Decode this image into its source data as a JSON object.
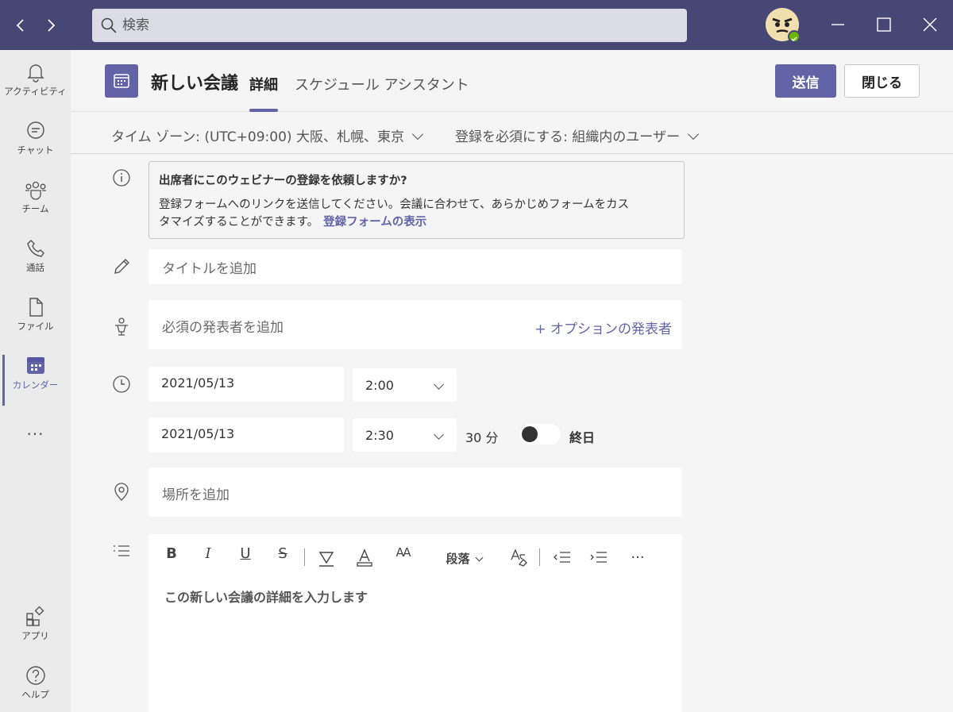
{
  "search": {
    "placeholder": "検索"
  },
  "rail": {
    "items": [
      {
        "label": "アクティビティ"
      },
      {
        "label": "チャット"
      },
      {
        "label": "チーム"
      },
      {
        "label": "通話"
      },
      {
        "label": "ファイル"
      },
      {
        "label": "カレンダー"
      },
      {
        "label": "..."
      },
      {
        "label": "アプリ"
      },
      {
        "label": "ヘルプ"
      }
    ]
  },
  "header": {
    "title": "新しい会議",
    "tabs": [
      {
        "label": "詳細"
      },
      {
        "label": "スケジュール アシスタント"
      }
    ],
    "send_label": "送信",
    "close_label": "閉じる"
  },
  "options": {
    "timezone": "タイム ゾーン: (UTC+09:00) 大阪、札幌、東京",
    "registration": "登録を必須にする: 組織内のユーザー"
  },
  "info": {
    "title": "出席者にこのウェビナーの登録を依頼しますか?",
    "body": "登録フォームへのリンクを送信してください。会議に合わせて、あらかじめフォームをカスタマイズすることができます。",
    "link": "登録フォームの表示"
  },
  "form": {
    "title_placeholder": "タイトルを追加",
    "presenter_placeholder": "必須の発表者を追加",
    "optional_presenter": "+ オプションの発表者",
    "start_date": "2021/05/13",
    "start_time": "2:00",
    "end_date": "2021/05/13",
    "end_time": "2:30",
    "duration": "30 分",
    "all_day_label": "終日",
    "all_day": false,
    "location_placeholder": "場所を追加"
  },
  "editor": {
    "toolbar": {
      "bold": "B",
      "italic": "I",
      "underline": "U",
      "strike": "S",
      "text_size": "AA",
      "paragraph": "段落",
      "more": "..."
    },
    "placeholder": "この新しい会議の詳細を入力します"
  },
  "colors": {
    "brand": "#6264a7",
    "titlebar": "#464775",
    "presence": "#6bb700"
  }
}
